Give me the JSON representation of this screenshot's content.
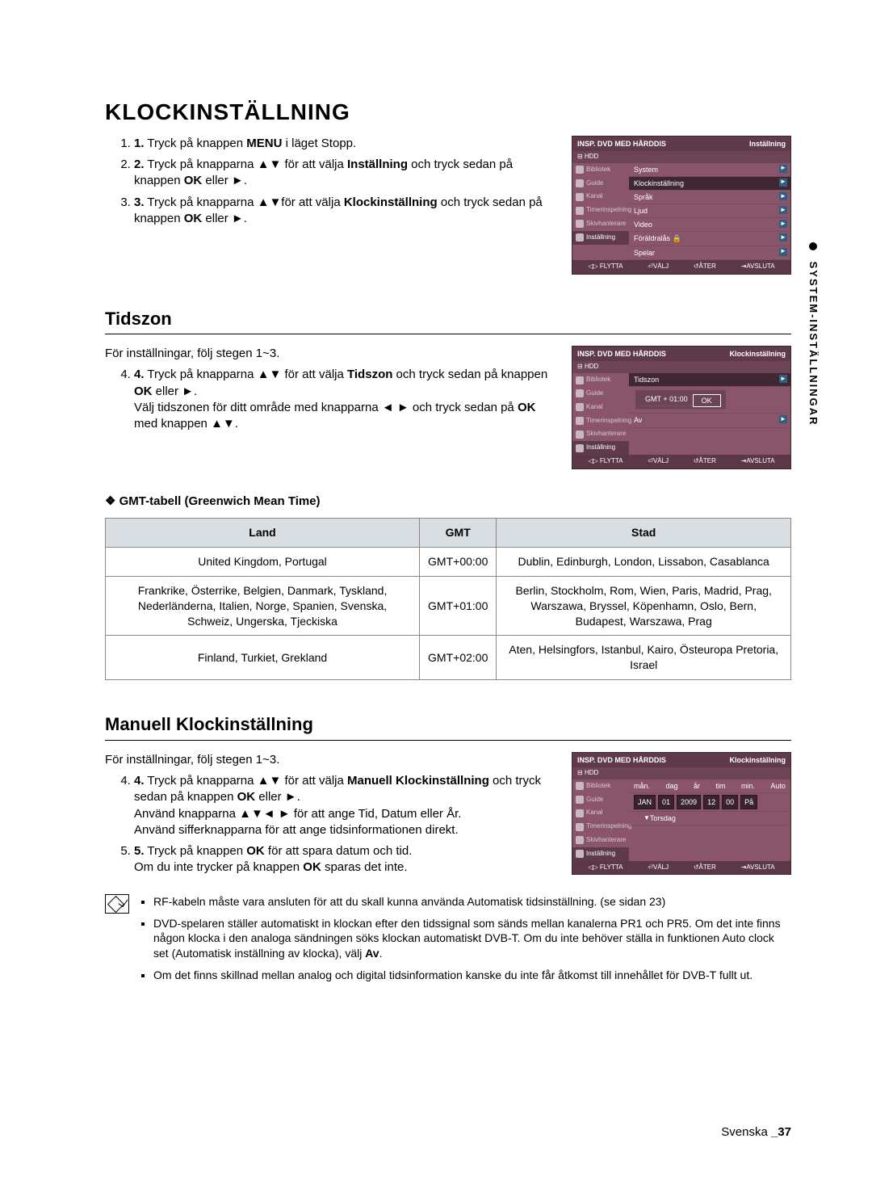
{
  "side_tab": "SYSTEM-INSTÄLLNINGAR",
  "title": "KLOCKINSTÄLLNING",
  "steps_top": [
    {
      "pre": "Tryck på knappen ",
      "bold": "MENU",
      "post": " i läget Stopp."
    },
    {
      "pre": "Tryck på knapparna ▲▼ för att välja ",
      "bold": "Inställning",
      "post": " och tryck sedan på knappen ",
      "bold2": "OK",
      "post2": " eller ►."
    },
    {
      "pre": "Tryck på knapparna ▲▼för att välja ",
      "bold": "Klockinställning",
      "post": " och tryck sedan på knappen ",
      "bold2": "OK",
      "post2": " eller ►."
    }
  ],
  "osd1": {
    "title_left": "INSP. DVD MED HÅRDDIS",
    "title_right": "Inställning",
    "disk": "HDD",
    "side": [
      "Bibliotek",
      "Guide",
      "Kanal",
      "Timerinspelning",
      "Skivhanterare",
      "Inställning"
    ],
    "side_sel": 5,
    "menu": [
      "System",
      "Klockinställning",
      "Språk",
      "Ljud",
      "Video",
      "Föräldralås 🔒",
      "Spelar"
    ],
    "menu_sel": 1,
    "bottom": [
      "◁▷ FLYTTA",
      "⏎VÄLJ",
      "↺ÅTER",
      "⇥AVSLUTA"
    ]
  },
  "tidszon": {
    "heading": "Tidszon",
    "intro": "För inställningar, följ stegen 1~3.",
    "step4_pre": "Tryck på knapparna ▲▼ för att välja ",
    "step4_bold": "Tidszon",
    "step4_mid": " och tryck sedan på knappen ",
    "step4_bold2": "OK",
    "step4_post": " eller ►.",
    "step4_l2": "Välj tidszonen för ditt område med knapparna ◄ ► och tryck sedan på ",
    "step4_l2_bold": "OK",
    "step4_l2_post": " med knappen ▲▼."
  },
  "osd2": {
    "title_left": "INSP. DVD MED HÅRDDIS",
    "title_right": "Klockinställning",
    "disk": "HDD",
    "menu_top": "Tidszon",
    "popup_value": "GMT + 01:00",
    "popup_ok": "OK",
    "right_label": "Av",
    "bottom": [
      "◁▷ FLYTTA",
      "⏎VÄLJ",
      "↺ÅTER",
      "⇥AVSLUTA"
    ]
  },
  "gmt_title": "❖ GMT-tabell (Greenwich Mean Time)",
  "gmt_headers": [
    "Land",
    "GMT",
    "Stad"
  ],
  "gmt_rows": [
    {
      "land": "United Kingdom, Portugal",
      "gmt": "GMT+00:00",
      "stad": "Dublin, Edinburgh, London, Lissabon, Casablanca"
    },
    {
      "land": "Frankrike, Österrike, Belgien, Danmark, Tyskland, Nederländerna, Italien, Norge, Spanien, Svenska, Schweiz, Ungerska, Tjeckiska",
      "gmt": "GMT+01:00",
      "stad": "Berlin, Stockholm, Rom, Wien, Paris, Madrid, Prag, Warszawa, Bryssel, Köpenhamn, Oslo, Bern, Budapest, Warszawa, Prag"
    },
    {
      "land": "Finland, Turkiet, Grekland",
      "gmt": "GMT+02:00",
      "stad": "Aten, Helsingfors, Istanbul, Kairo, Östeuropa Pretoria, Israel"
    }
  ],
  "manuell": {
    "heading": "Manuell Klockinställning",
    "intro": "För inställningar, följ stegen 1~3.",
    "s4_pre": "Tryck på knapparna ▲▼ för att välja ",
    "s4_bold": "Manuell Klockinställning",
    "s4_mid": " och tryck sedan på knappen ",
    "s4_bold2": "OK",
    "s4_post": " eller ►.",
    "s4_l2": "Använd knapparna ▲▼◄ ► för att ange Tid, Datum eller År.",
    "s4_l3": "Använd sifferknapparna för att ange tidsinformationen direkt.",
    "s5_pre": "Tryck på knappen ",
    "s5_bold": "OK",
    "s5_post": " för att spara datum och tid.",
    "s5_l2_pre": "Om du inte trycker på knappen ",
    "s5_l2_bold": "OK",
    "s5_l2_post": " sparas det inte."
  },
  "osd3": {
    "title_left": "INSP. DVD MED HÅRDDIS",
    "title_right": "Klockinställning",
    "disk": "HDD",
    "labels": [
      "mån.",
      "dag",
      "år",
      "tim",
      "min.",
      "Auto"
    ],
    "values": [
      "JAN",
      "01",
      "2009",
      "12",
      "00",
      "På"
    ],
    "day": "Torsdag",
    "bottom": [
      "◁▷ FLYTTA",
      "⏎VÄLJ",
      "↺ÅTER",
      "⇥AVSLUTA"
    ]
  },
  "notes": [
    "RF-kabeln måste vara ansluten för att du skall kunna använda Automatisk tidsinställning. (se sidan 23)",
    "DVD-spelaren ställer automatiskt in klockan efter den tidssignal som sänds mellan kanalerna PR1 och PR5. Om det inte finns någon klocka i den analoga sändningen söks klockan automatiskt DVB-T. Om du inte behöver ställa in funktionen Auto clock set (Automatisk inställning av klocka), välj Av.",
    "Om det finns skillnad mellan analog och digital tidsinformation kanske du inte får åtkomst till innehållet för DVB-T fullt ut."
  ],
  "note_bold": "Av",
  "footer_lang": "Svenska ",
  "footer_page": "_37"
}
